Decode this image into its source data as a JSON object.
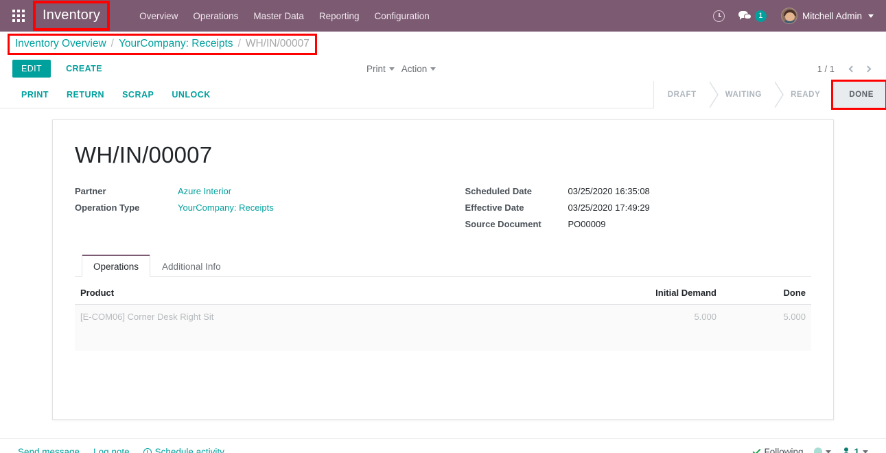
{
  "navbar": {
    "apps_icon": "apps-grid-icon",
    "brand": "Inventory",
    "menu": [
      {
        "label": "Overview"
      },
      {
        "label": "Operations"
      },
      {
        "label": "Master Data"
      },
      {
        "label": "Reporting"
      },
      {
        "label": "Configuration"
      }
    ],
    "activities_icon": "clock-icon",
    "messages_icon": "chat-bubble-icon",
    "messages_count": "1",
    "user_name": "Mitchell Admin",
    "brand_color": "#7c5a72",
    "accent_color": "#00a09d"
  },
  "breadcrumb": {
    "items": [
      {
        "label": "Inventory Overview",
        "type": "link"
      },
      {
        "label": "YourCompany: Receipts",
        "type": "link"
      },
      {
        "label": "WH/IN/00007",
        "type": "current"
      }
    ],
    "separator": "/",
    "highlight_color": "#ff0000"
  },
  "control_panel": {
    "edit_label": "EDIT",
    "create_label": "CREATE",
    "print_label": "Print",
    "action_label": "Action",
    "pager_value": "1 / 1",
    "prev_icon": "chevron-left-icon",
    "next_icon": "chevron-right-icon"
  },
  "workflow": {
    "buttons": [
      {
        "label": "PRINT"
      },
      {
        "label": "RETURN"
      },
      {
        "label": "SCRAP"
      },
      {
        "label": "UNLOCK"
      }
    ],
    "statuses": [
      {
        "label": "DRAFT",
        "active": false
      },
      {
        "label": "WAITING",
        "active": false
      },
      {
        "label": "READY",
        "active": false
      },
      {
        "label": "DONE",
        "active": true
      }
    ]
  },
  "record": {
    "title": "WH/IN/00007",
    "left_fields": [
      {
        "label": "Partner",
        "value": "Azure Interior",
        "is_link": true
      },
      {
        "label": "Operation Type",
        "value": "YourCompany: Receipts",
        "is_link": true
      }
    ],
    "right_fields": [
      {
        "label": "Scheduled Date",
        "value": "03/25/2020 16:35:08",
        "is_link": false
      },
      {
        "label": "Effective Date",
        "value": "03/25/2020 17:49:29",
        "is_link": false
      },
      {
        "label": "Source Document",
        "value": "PO00009",
        "is_link": false
      }
    ]
  },
  "notebook": {
    "tabs": [
      {
        "label": "Operations",
        "active": true
      },
      {
        "label": "Additional Info",
        "active": false
      }
    ]
  },
  "operations_table": {
    "headers": {
      "product": "Product",
      "initial_demand": "Initial Demand",
      "done": "Done"
    },
    "rows": [
      {
        "product": "[E-COM06] Corner Desk Right Sit",
        "initial_demand": "5.000",
        "done": "5.000"
      }
    ]
  },
  "chatter": {
    "send_message": "Send message",
    "log_note": "Log note",
    "schedule_activity": "Schedule activity",
    "schedule_icon": "clock-icon",
    "following_label": "Following",
    "following_icon": "check-icon",
    "bell_icon": "bell-icon",
    "followers_icon": "user-icon",
    "followers_count": "1"
  }
}
